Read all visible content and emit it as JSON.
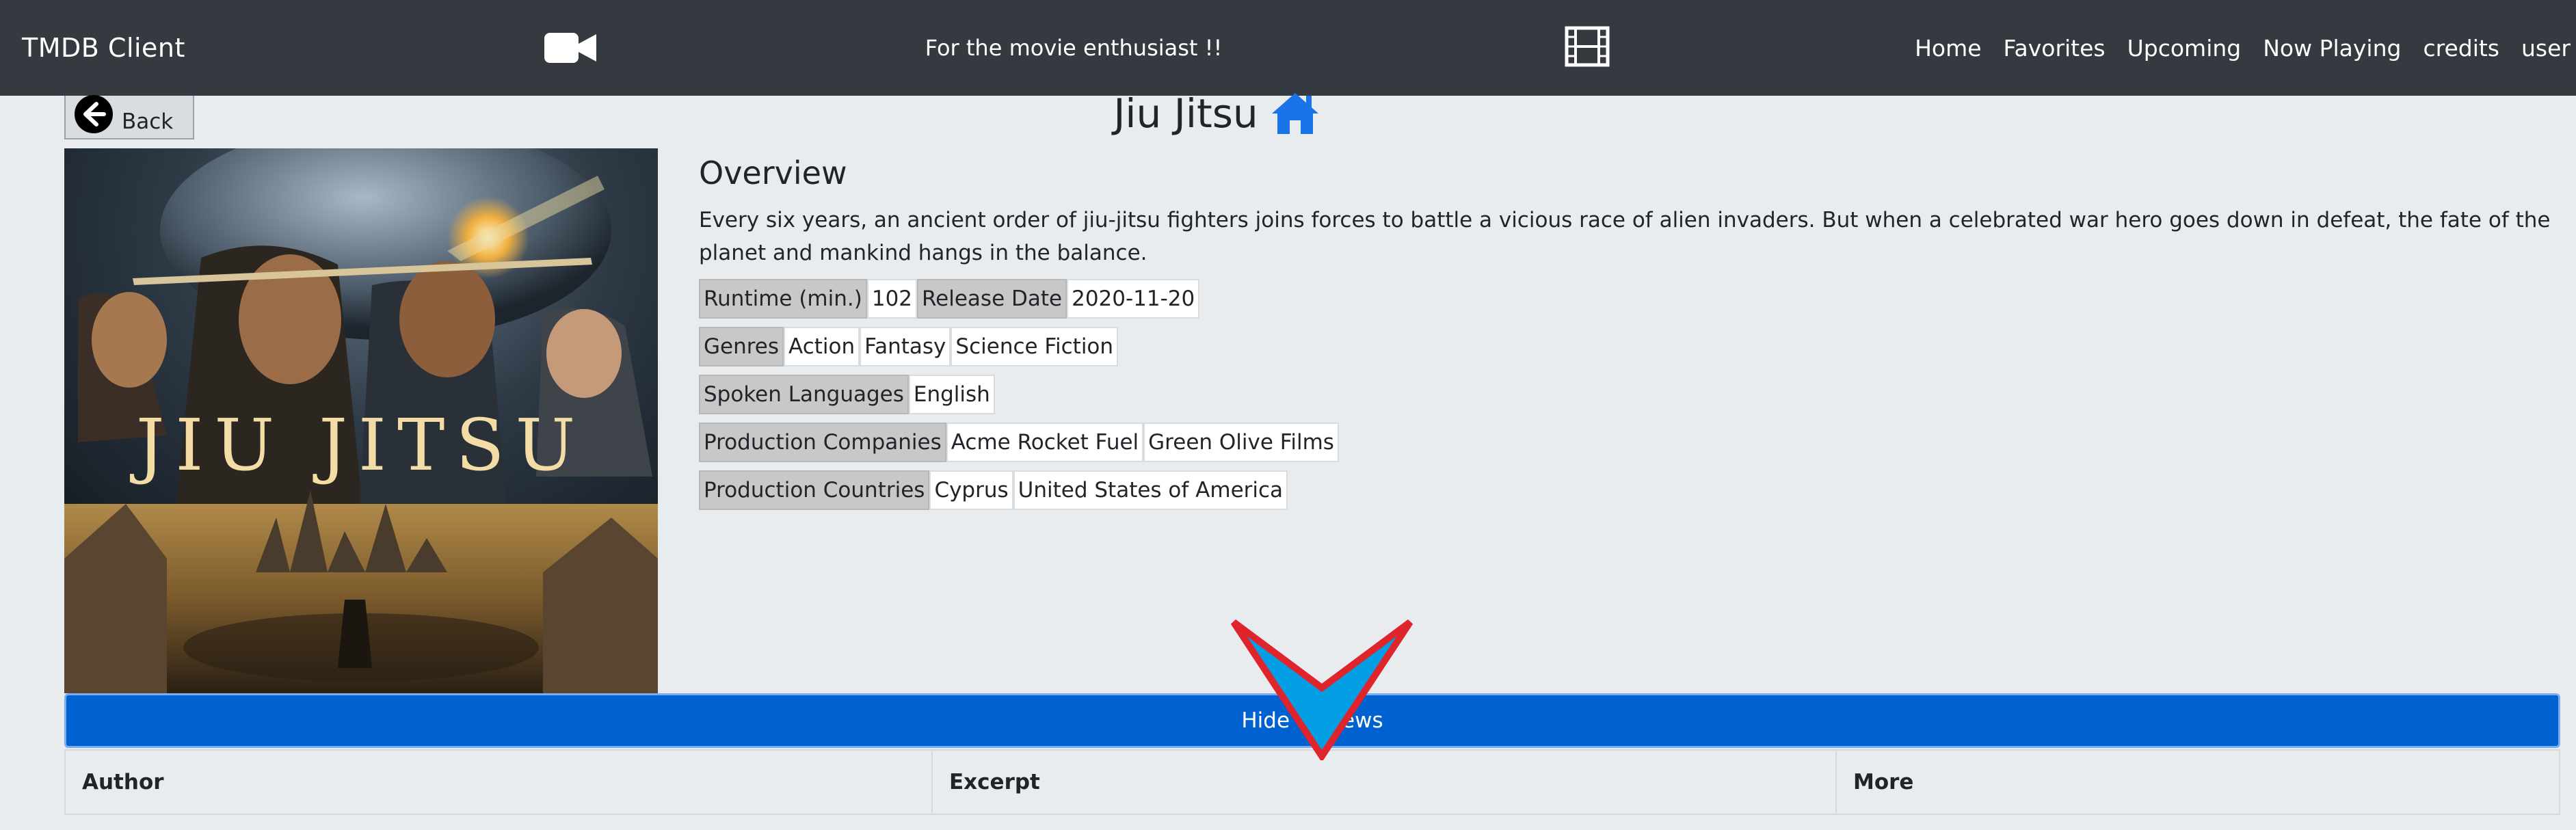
{
  "navbar": {
    "brand": "TMDB Client",
    "tagline": "For the movie enthusiast !!",
    "left_icon": "video-camera-icon",
    "right_icon": "film-strip-icon",
    "links": [
      "Home",
      "Favorites",
      "Upcoming",
      "Now Playing",
      "credits",
      "user"
    ]
  },
  "back_button": {
    "label": "Back",
    "icon": "arrow-left-circle-icon"
  },
  "movie": {
    "title": "Jiu Jitsu",
    "title_icon": "home-icon",
    "poster_title": "JIU JITSU",
    "overview_heading": "Overview",
    "overview": "Every six years, an ancient order of jiu-jitsu fighters joins forces to battle a vicious race of alien invaders. But when a celebrated war hero goes down in defeat, the fate of the planet and mankind hangs in the balance.",
    "runtime_label": "Runtime (min.)",
    "runtime": "102",
    "release_label": "Release Date",
    "release_date": "2020-11-20",
    "genres_label": "Genres",
    "genres": [
      "Action",
      "Fantasy",
      "Science Fiction"
    ],
    "languages_label": "Spoken Languages",
    "languages": [
      "English"
    ],
    "companies_label": "Production Companies",
    "companies": [
      "Acme Rocket Fuel",
      "Green Olive Films"
    ],
    "countries_label": "Production Countries",
    "countries": [
      "Cyprus",
      "United States of America"
    ]
  },
  "reviews": {
    "toggle_label": "Hide Reviews",
    "columns": [
      "Author",
      "Excerpt",
      "More"
    ]
  },
  "colors": {
    "navbar_bg": "#343a40",
    "page_bg": "#e9ecef",
    "primary": "#0062d1",
    "link_icon": "#1a73e8",
    "cursor_fill": "#049ee4",
    "cursor_outline": "#e0242c"
  }
}
